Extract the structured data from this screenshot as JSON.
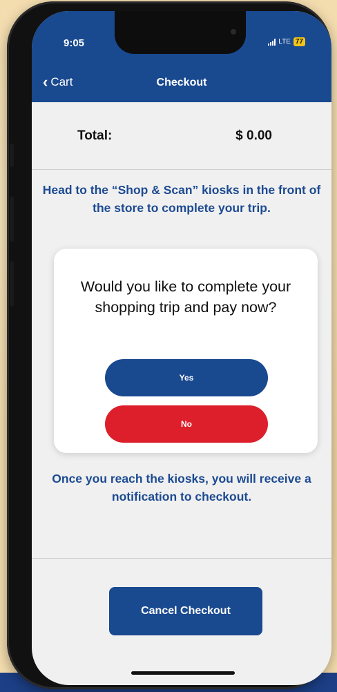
{
  "status_bar": {
    "time": "9:05",
    "network": "LTE",
    "battery": "77"
  },
  "nav": {
    "back_label": "Cart",
    "title": "Checkout"
  },
  "total": {
    "label": "Total:",
    "value": "$ 0.00"
  },
  "instructions": "Head to the “Shop & Scan” kiosks in the front of the store to complete your trip.",
  "dialog": {
    "question": "Would you like to complete your shopping trip and pay now?",
    "yes_label": "Yes",
    "no_label": "No"
  },
  "note": "Once you reach the kiosks, you will receive a notification to checkout.",
  "cancel_label": "Cancel Checkout",
  "colors": {
    "primary": "#19498f",
    "danger": "#dc1f2b",
    "text_accent": "#1c4a92",
    "background": "#f0f0f0"
  }
}
